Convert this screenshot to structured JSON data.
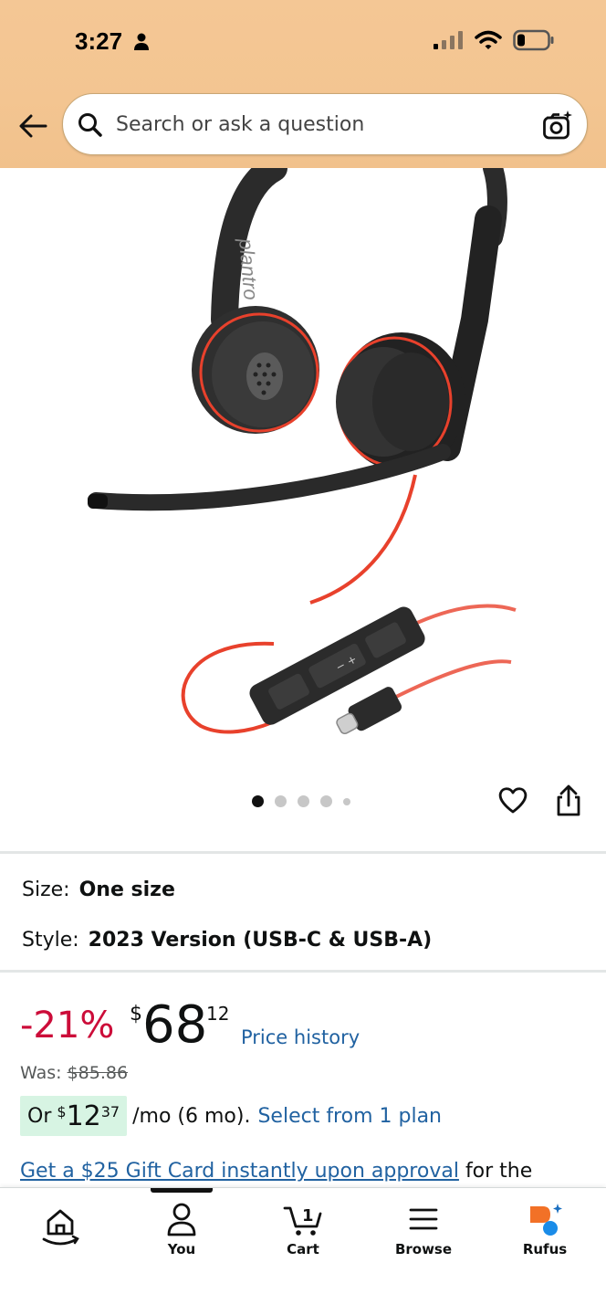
{
  "status_bar": {
    "time": "3:27"
  },
  "search": {
    "placeholder": "Search or ask a question"
  },
  "carousel": {
    "image_count": 5,
    "active_index": 0
  },
  "variants": {
    "size": {
      "label": "Size:",
      "value": "One size"
    },
    "style": {
      "label": "Style:",
      "value": "2023 Version (USB-C & USB-A)"
    }
  },
  "price": {
    "discount": "-21%",
    "currency": "$",
    "whole": "68",
    "fraction": "12",
    "history_link": "Price history",
    "was_label": "Was:",
    "was_value": "$85.86"
  },
  "monthly": {
    "or": "Or",
    "currency": "$",
    "whole": "12",
    "fraction": "37",
    "suffix": "/mo (6 mo).",
    "plan_link": "Select from 1 plan"
  },
  "gift": {
    "link": "Get a $25 Gift Card instantly upon approval",
    "rest": "for the"
  },
  "bottom_nav": {
    "items": [
      {
        "label": "",
        "icon": "home-icon"
      },
      {
        "label": "You",
        "icon": "person-icon"
      },
      {
        "label": "Cart",
        "icon": "cart-icon",
        "badge": "1"
      },
      {
        "label": "Browse",
        "icon": "menu-icon"
      },
      {
        "label": "Rufus",
        "icon": "rufus-icon"
      }
    ]
  },
  "colors": {
    "header_bg": "#f3c591",
    "link": "#2162a1",
    "discount": "#cc0c39",
    "monthly_badge": "#d7f4e3",
    "headset_accent": "#e8412c"
  }
}
